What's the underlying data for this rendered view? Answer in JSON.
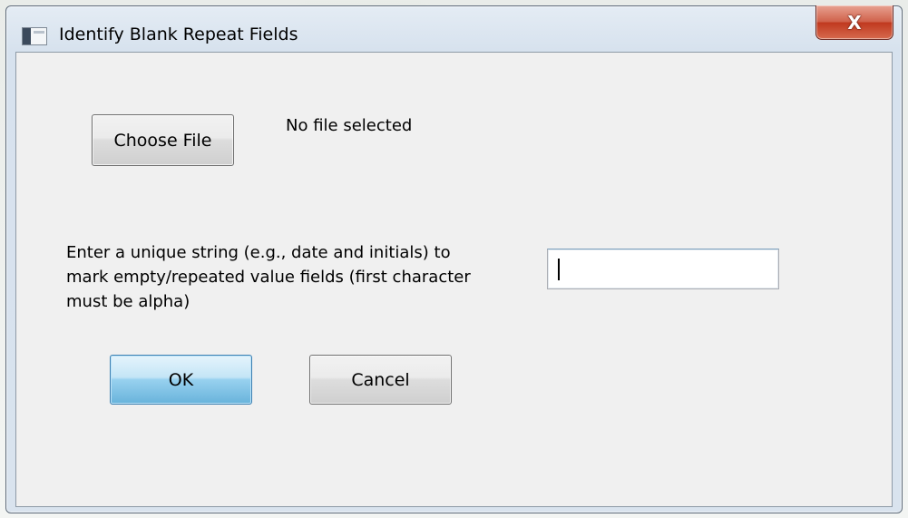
{
  "window": {
    "title": "Identify Blank Repeat Fields",
    "close_symbol": "X",
    "icon": "app-window-icon"
  },
  "file_section": {
    "choose_label": "Choose File",
    "status_text": "No file selected"
  },
  "string_section": {
    "prompt_lines": [
      "Enter a unique string (e.g., date and initials) to",
      "mark empty/repeated value fields (first character",
      "must be alpha)"
    ],
    "input_value": ""
  },
  "actions": {
    "ok_label": "OK",
    "cancel_label": "Cancel"
  },
  "colors": {
    "dialog_face": "#f0f0f0",
    "default_button_accent": "#3c7fb1",
    "close_button": "#c0391f"
  }
}
